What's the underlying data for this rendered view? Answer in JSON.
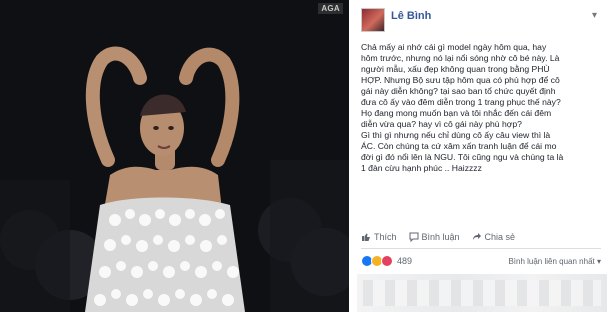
{
  "photo": {
    "watermark": "AGA",
    "alt": "model"
  },
  "post": {
    "author": "Lê Bình",
    "lines": [
      "Chả mấy ai nhớ cái gì model ngày hôm qua, hay",
      "hôm trước, nhưng nó lại nổi sóng nhờ cô bé này. Là",
      "người mẫu, xấu đẹp không quan trong bằng PHÙ",
      "HỢP. Nhưng Bộ sưu tập hôm qua có phù hợp để cô",
      "gái này diễn không? tại sao ban tổ chức quyết định",
      "đưa cô ấy vào đêm diễn trong 1 trang phục thế này?",
      "Họ đang mong muốn bạn và tôi nhắc đến cái đêm",
      "diễn vừa qua? hay vì cô gái này phù hợp?",
      "Gì thì gì nhưng nếu chỉ dùng cô ấy câu view thì là",
      "ÁC. Còn chúng ta cứ xâm xấn tranh luận để cái mo",
      "đời gì đó nổi lên là NGU. Tôi cũng ngu và chúng ta là",
      "1 đàn cừu hạnh phúc .. Haizzzz"
    ],
    "actions": {
      "like": "Thích",
      "comment": "Bình luận",
      "share": "Chia sẻ"
    },
    "reaction_count": "489",
    "sort_label": "Bình luận liên quan nhất",
    "colors": {
      "link": "#365899",
      "like_rx": "#1877f2",
      "haha_rx": "#f7b125",
      "love_rx": "#e4405f"
    }
  }
}
